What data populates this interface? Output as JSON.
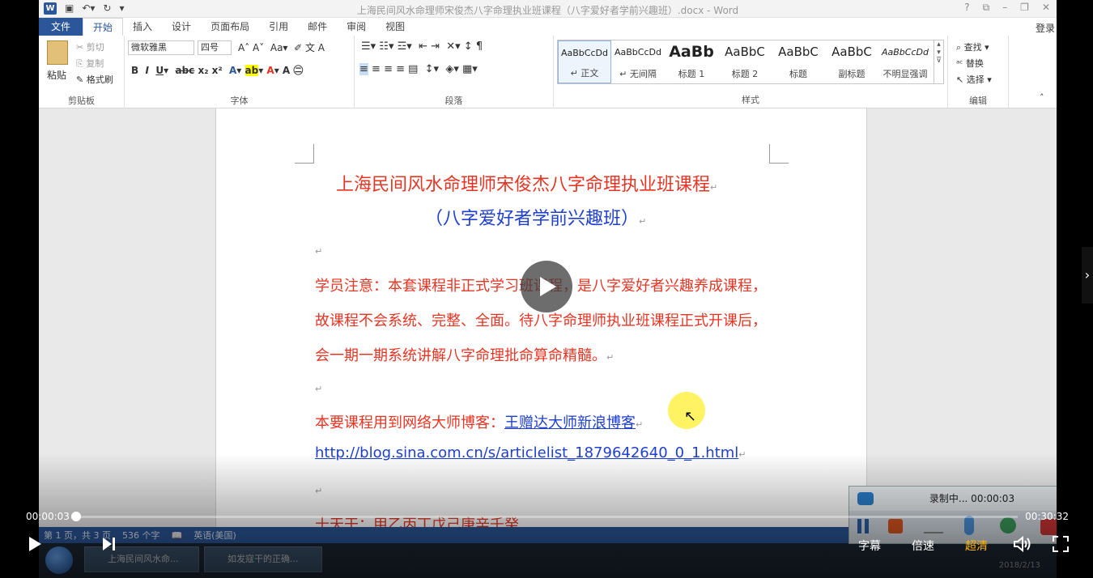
{
  "word": {
    "title": "上海民间风水命理师宋俊杰八字命理执业班课程（八字爱好者学前兴趣班）.docx - Word",
    "tabs": [
      "文件",
      "开始",
      "插入",
      "设计",
      "页面布局",
      "引用",
      "邮件",
      "审阅",
      "视图"
    ],
    "login": "登录",
    "clipboard": {
      "paste": "粘贴",
      "cut": "剪切",
      "copy": "复制",
      "format_painter": "格式刷",
      "label": "剪贴板"
    },
    "font": {
      "name": "微软雅黑",
      "size": "四号",
      "label": "字体"
    },
    "paragraph_label": "段落",
    "styles": {
      "label": "样式",
      "items": [
        {
          "preview": "AaBbCcDd",
          "name": "↵ 正文"
        },
        {
          "preview": "AaBbCcDd",
          "name": "↵ 无间隔"
        },
        {
          "preview": "AaBb",
          "name": "标题 1"
        },
        {
          "preview": "AaBbC",
          "name": "标题 2"
        },
        {
          "preview": "AaBbC",
          "name": "标题"
        },
        {
          "preview": "AaBbC",
          "name": "副标题"
        },
        {
          "preview": "AaBbCcDd",
          "name": "不明显强调"
        }
      ]
    },
    "editing": {
      "find": "查找",
      "replace": "替换",
      "select": "选择",
      "label": "编辑"
    },
    "status": {
      "page": "第 1 页，共 3 页",
      "words": "536 个字",
      "lang": "英语(美国)"
    }
  },
  "document": {
    "title": "上海民间风水命理师宋俊杰八字命理执业班课程",
    "subtitle": "（八字爱好者学前兴趣班）",
    "notice1": "学员注意：本套课程非正式学习班课程，是八字爱好者兴趣养成课程，",
    "notice2": "故课程不会系统、完整、全面。待八字命理师执业班课程正式开课后，",
    "notice3": "会一期一期系统讲解八字命理批命算命精髓。",
    "blog_prefix": "本要课程用到网络大师博客：",
    "blog_name": "王赠达大师新浪博客",
    "blog_url": "http://blog.sina.com.cn/s/articlelist_1879642640_0_1.html",
    "cut_line": "十天干：甲乙丙丁戊己庚辛壬癸"
  },
  "taskbar": {
    "item1": "上海民间风水命...",
    "item2": "如发寇干的正确...",
    "date": "2018/2/13"
  },
  "recorder": {
    "status": "录制中... 00:00:03"
  },
  "player": {
    "current_time": "00:00:03",
    "duration": "00:30:32",
    "progress": 0.0016,
    "subtitle_btn": "字幕",
    "speed_btn": "倍速",
    "quality_btn": "超清"
  }
}
